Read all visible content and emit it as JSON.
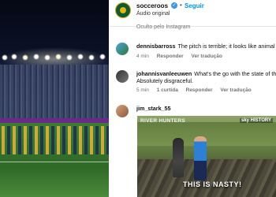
{
  "post": {
    "author": "socceroos",
    "follow_label": "Seguir",
    "separator": "•",
    "audio_label": "Áudio original",
    "hidden_note": "Oculto pelo Instagram",
    "brand_color": "#0095f6"
  },
  "comments": [
    {
      "user": "dennisbarross",
      "text": "The pitch is terrible; it looks like animal",
      "time": "4 min",
      "reply_label": "Responder",
      "translate_label": "Ver tradução"
    },
    {
      "user": "johannisvanleeuwen",
      "text": "What's the go with the state of the",
      "text2": "Absolutely disgraceful.",
      "time": "5 min",
      "likes": "1 curtida",
      "reply_label": "Responder",
      "translate_label": "Ver tradução"
    },
    {
      "user": "jim_stark_55",
      "video": {
        "show_title": "RIVER HUNTERS",
        "channel_logo": "sky HISTORY",
        "caption": "THIS IS NASTY!"
      }
    }
  ],
  "icons": [
    "verified-badge-icon"
  ]
}
